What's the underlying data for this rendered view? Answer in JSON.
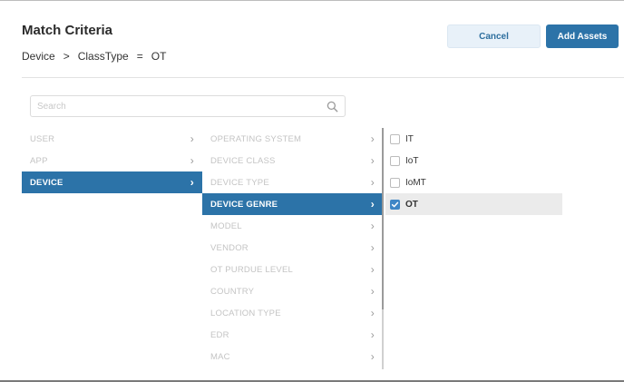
{
  "dialog": {
    "title": "Match Criteria",
    "breadcrumb": {
      "field": "Device",
      "sep": ">",
      "attr": "ClassType",
      "op": "=",
      "value": "OT"
    },
    "cancel_label": "Cancel",
    "add_label": "Add Assets"
  },
  "search": {
    "placeholder": "Search",
    "value": ""
  },
  "categories": [
    {
      "label": "USER",
      "selected": false
    },
    {
      "label": "APP",
      "selected": false
    },
    {
      "label": "DEVICE",
      "selected": true
    }
  ],
  "attributes": [
    {
      "label": "OPERATING SYSTEM",
      "selected": false
    },
    {
      "label": "DEVICE CLASS",
      "selected": false
    },
    {
      "label": "DEVICE TYPE",
      "selected": false
    },
    {
      "label": "DEVICE GENRE",
      "selected": true
    },
    {
      "label": "MODEL",
      "selected": false
    },
    {
      "label": "VENDOR",
      "selected": false
    },
    {
      "label": "OT PURDUE LEVEL",
      "selected": false
    },
    {
      "label": "COUNTRY",
      "selected": false
    },
    {
      "label": "LOCATION TYPE",
      "selected": false
    },
    {
      "label": "EDR",
      "selected": false
    },
    {
      "label": "MAC",
      "selected": false
    }
  ],
  "values": [
    {
      "label": "IT",
      "checked": false
    },
    {
      "label": "IoT",
      "checked": false
    },
    {
      "label": "IoMT",
      "checked": false
    },
    {
      "label": "OT",
      "checked": true
    }
  ],
  "icons": {
    "search": "search-icon",
    "chevron": "chevron-right-icon",
    "check": "check-icon"
  },
  "colors": {
    "accent": "#2c73a8",
    "cancel_bg": "#e8f1f9",
    "checkbox_checked": "#3f86c6"
  }
}
